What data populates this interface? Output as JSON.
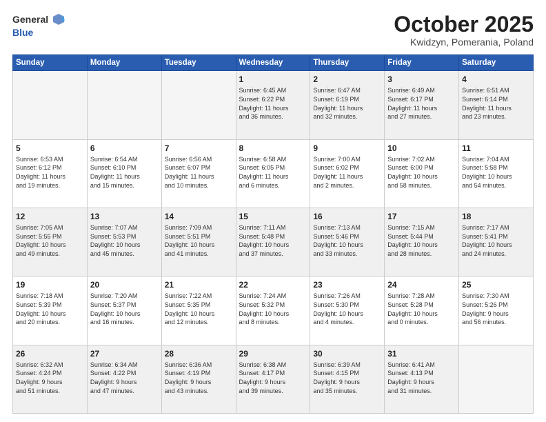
{
  "header": {
    "logo_general": "General",
    "logo_blue": "Blue",
    "title": "October 2025",
    "location": "Kwidzyn, Pomerania, Poland"
  },
  "weekdays": [
    "Sunday",
    "Monday",
    "Tuesday",
    "Wednesday",
    "Thursday",
    "Friday",
    "Saturday"
  ],
  "weeks": [
    [
      {
        "day": "",
        "info": ""
      },
      {
        "day": "",
        "info": ""
      },
      {
        "day": "",
        "info": ""
      },
      {
        "day": "1",
        "info": "Sunrise: 6:45 AM\nSunset: 6:22 PM\nDaylight: 11 hours\nand 36 minutes."
      },
      {
        "day": "2",
        "info": "Sunrise: 6:47 AM\nSunset: 6:19 PM\nDaylight: 11 hours\nand 32 minutes."
      },
      {
        "day": "3",
        "info": "Sunrise: 6:49 AM\nSunset: 6:17 PM\nDaylight: 11 hours\nand 27 minutes."
      },
      {
        "day": "4",
        "info": "Sunrise: 6:51 AM\nSunset: 6:14 PM\nDaylight: 11 hours\nand 23 minutes."
      }
    ],
    [
      {
        "day": "5",
        "info": "Sunrise: 6:53 AM\nSunset: 6:12 PM\nDaylight: 11 hours\nand 19 minutes."
      },
      {
        "day": "6",
        "info": "Sunrise: 6:54 AM\nSunset: 6:10 PM\nDaylight: 11 hours\nand 15 minutes."
      },
      {
        "day": "7",
        "info": "Sunrise: 6:56 AM\nSunset: 6:07 PM\nDaylight: 11 hours\nand 10 minutes."
      },
      {
        "day": "8",
        "info": "Sunrise: 6:58 AM\nSunset: 6:05 PM\nDaylight: 11 hours\nand 6 minutes."
      },
      {
        "day": "9",
        "info": "Sunrise: 7:00 AM\nSunset: 6:02 PM\nDaylight: 11 hours\nand 2 minutes."
      },
      {
        "day": "10",
        "info": "Sunrise: 7:02 AM\nSunset: 6:00 PM\nDaylight: 10 hours\nand 58 minutes."
      },
      {
        "day": "11",
        "info": "Sunrise: 7:04 AM\nSunset: 5:58 PM\nDaylight: 10 hours\nand 54 minutes."
      }
    ],
    [
      {
        "day": "12",
        "info": "Sunrise: 7:05 AM\nSunset: 5:55 PM\nDaylight: 10 hours\nand 49 minutes."
      },
      {
        "day": "13",
        "info": "Sunrise: 7:07 AM\nSunset: 5:53 PM\nDaylight: 10 hours\nand 45 minutes."
      },
      {
        "day": "14",
        "info": "Sunrise: 7:09 AM\nSunset: 5:51 PM\nDaylight: 10 hours\nand 41 minutes."
      },
      {
        "day": "15",
        "info": "Sunrise: 7:11 AM\nSunset: 5:48 PM\nDaylight: 10 hours\nand 37 minutes."
      },
      {
        "day": "16",
        "info": "Sunrise: 7:13 AM\nSunset: 5:46 PM\nDaylight: 10 hours\nand 33 minutes."
      },
      {
        "day": "17",
        "info": "Sunrise: 7:15 AM\nSunset: 5:44 PM\nDaylight: 10 hours\nand 28 minutes."
      },
      {
        "day": "18",
        "info": "Sunrise: 7:17 AM\nSunset: 5:41 PM\nDaylight: 10 hours\nand 24 minutes."
      }
    ],
    [
      {
        "day": "19",
        "info": "Sunrise: 7:18 AM\nSunset: 5:39 PM\nDaylight: 10 hours\nand 20 minutes."
      },
      {
        "day": "20",
        "info": "Sunrise: 7:20 AM\nSunset: 5:37 PM\nDaylight: 10 hours\nand 16 minutes."
      },
      {
        "day": "21",
        "info": "Sunrise: 7:22 AM\nSunset: 5:35 PM\nDaylight: 10 hours\nand 12 minutes."
      },
      {
        "day": "22",
        "info": "Sunrise: 7:24 AM\nSunset: 5:32 PM\nDaylight: 10 hours\nand 8 minutes."
      },
      {
        "day": "23",
        "info": "Sunrise: 7:26 AM\nSunset: 5:30 PM\nDaylight: 10 hours\nand 4 minutes."
      },
      {
        "day": "24",
        "info": "Sunrise: 7:28 AM\nSunset: 5:28 PM\nDaylight: 10 hours\nand 0 minutes."
      },
      {
        "day": "25",
        "info": "Sunrise: 7:30 AM\nSunset: 5:26 PM\nDaylight: 9 hours\nand 56 minutes."
      }
    ],
    [
      {
        "day": "26",
        "info": "Sunrise: 6:32 AM\nSunset: 4:24 PM\nDaylight: 9 hours\nand 51 minutes."
      },
      {
        "day": "27",
        "info": "Sunrise: 6:34 AM\nSunset: 4:22 PM\nDaylight: 9 hours\nand 47 minutes."
      },
      {
        "day": "28",
        "info": "Sunrise: 6:36 AM\nSunset: 4:19 PM\nDaylight: 9 hours\nand 43 minutes."
      },
      {
        "day": "29",
        "info": "Sunrise: 6:38 AM\nSunset: 4:17 PM\nDaylight: 9 hours\nand 39 minutes."
      },
      {
        "day": "30",
        "info": "Sunrise: 6:39 AM\nSunset: 4:15 PM\nDaylight: 9 hours\nand 35 minutes."
      },
      {
        "day": "31",
        "info": "Sunrise: 6:41 AM\nSunset: 4:13 PM\nDaylight: 9 hours\nand 31 minutes."
      },
      {
        "day": "",
        "info": ""
      }
    ]
  ]
}
